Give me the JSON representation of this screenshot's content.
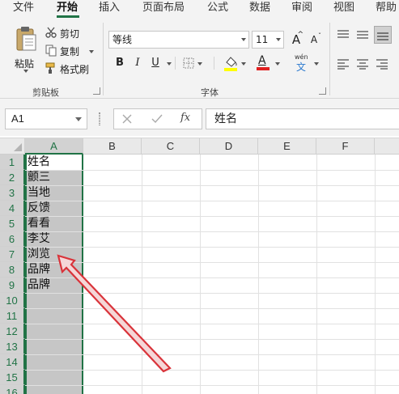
{
  "tabs": [
    {
      "label": "文件",
      "active": false
    },
    {
      "label": "开始",
      "active": true
    },
    {
      "label": "插入",
      "active": false
    },
    {
      "label": "页面布局",
      "active": false
    },
    {
      "label": "公式",
      "active": false
    },
    {
      "label": "数据",
      "active": false
    },
    {
      "label": "审阅",
      "active": false
    },
    {
      "label": "视图",
      "active": false
    },
    {
      "label": "帮助",
      "active": false
    }
  ],
  "clipboard": {
    "paste_label": "粘贴",
    "cut_label": "剪切",
    "copy_label": "复制",
    "format_painter_label": "格式刷",
    "group_label": "剪贴板"
  },
  "font": {
    "font_name": "等线",
    "font_size": "11",
    "bold": "B",
    "italic": "I",
    "underline": "U",
    "grow": "A",
    "shrink": "A",
    "font_color_glyph": "A",
    "phonetic_top": "wén",
    "phonetic_bottom": "文",
    "group_label": "字体"
  },
  "namebox": {
    "value": "A1"
  },
  "formula_bar": {
    "fx": "fx",
    "value": "姓名"
  },
  "columns": [
    "A",
    "B",
    "C",
    "D",
    "E",
    "F"
  ],
  "selected_column": "A",
  "rows": [
    "1",
    "2",
    "3",
    "4",
    "5",
    "6",
    "7",
    "8",
    "9",
    "10",
    "11",
    "12",
    "13",
    "14",
    "15",
    "16"
  ],
  "cells_A": [
    "姓名",
    "颤三",
    "当地",
    "反馈",
    "看看",
    "李艾",
    "浏览",
    "品牌",
    "品牌"
  ],
  "colors": {
    "accent": "#217346",
    "annotation_arrow": "#d9333a"
  }
}
